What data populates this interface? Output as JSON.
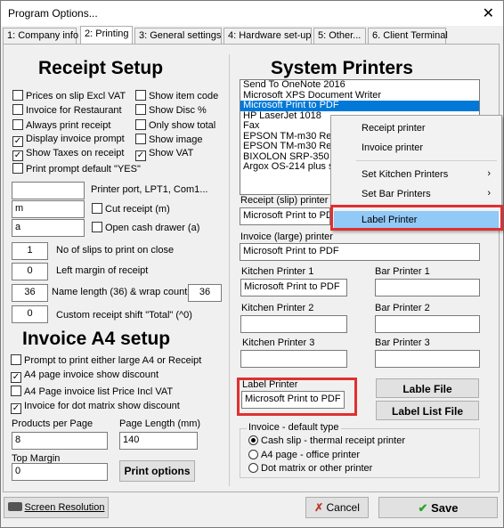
{
  "window": {
    "title": "Program Options...",
    "close_glyph": "✕"
  },
  "tabs": [
    "1: Company info",
    "2: Printing",
    "3: General settings",
    "4: Hardware set-up",
    "5: Other...",
    "6. Client Terminal"
  ],
  "receipt": {
    "title": "Receipt Setup",
    "checks_left": [
      {
        "label": "Prices on slip Excl VAT",
        "checked": false
      },
      {
        "label": "Invoice for Restaurant",
        "checked": false
      },
      {
        "label": "Always print receipt",
        "checked": false
      },
      {
        "label": "Display invoice prompt",
        "checked": true
      },
      {
        "label": "Show Taxes on receipt",
        "checked": true
      },
      {
        "label": "Print prompt default \"YES\"",
        "checked": false
      }
    ],
    "checks_right": [
      {
        "label": "Show item code",
        "checked": false
      },
      {
        "label": "Show Disc %",
        "checked": false
      },
      {
        "label": "Only show total",
        "checked": false
      },
      {
        "label": "Show image",
        "checked": false
      },
      {
        "label": "Show VAT",
        "checked": true
      }
    ],
    "port_label": "Printer port, LPT1, Com1...",
    "port_value": "",
    "cut_value": "m",
    "cut_label": "Cut receipt (m)",
    "drawer_value": "a",
    "drawer_label": "Open cash drawer (a)",
    "slips_value": "1",
    "slips_label": "No of slips to print on close",
    "margin_value": "0",
    "margin_label": "Left margin of receipt",
    "name_length_value": "36",
    "name_length_label": "Name length (36) & wrap count",
    "wrap_value": "36",
    "shift_value": "0",
    "shift_label": "Custom receipt shift \"Total\" (^0)"
  },
  "invoice": {
    "title": "Invoice A4 setup",
    "checks": [
      {
        "label": "Prompt to print either large A4 or Receipt",
        "checked": false
      },
      {
        "label": "A4 page invoice show discount",
        "checked": true
      },
      {
        "label": "A4 Page invoice list Price Incl VAT",
        "checked": false
      },
      {
        "label": "Invoice for dot matrix show discount",
        "checked": true
      }
    ],
    "products_label": "Products per Page",
    "products_value": "8",
    "page_length_label": "Page Length (mm)",
    "page_length_value": "140",
    "top_margin_label": "Top Margin",
    "top_margin_value": "0",
    "print_options_label": "Print options"
  },
  "system": {
    "title": "System Printers",
    "printers": [
      "Send To OneNote 2016",
      "Microsoft XPS Document Writer",
      "Microsoft Print to PDF",
      "HP LaserJet 1018",
      "Fax",
      "EPSON TM-m30 Re",
      "EPSON TM-m30 Re",
      "BIXOLON SRP-350",
      "Argox OS-214 plus s"
    ],
    "selected_index": 2,
    "receipt_label": "Receipt (slip) printer (r",
    "receipt_value": "Microsoft Print to PD",
    "invoice_label": "Invoice (large) printer",
    "invoice_value": "Microsoft Print to PDF",
    "kitchen1_label": "Kitchen Printer 1",
    "kitchen1_value": "Microsoft Print to PDF",
    "bar1_label": "Bar Printer 1",
    "bar1_value": "",
    "kitchen2_label": "Kitchen Printer 2",
    "kitchen2_value": "",
    "bar2_label": "Bar Printer 2",
    "bar2_value": "",
    "kitchen3_label": "Kitchen Printer 3",
    "kitchen3_value": "",
    "bar3_label": "Bar Printer 3",
    "bar3_value": "",
    "label_printer_label": "Label Printer",
    "label_printer_value": "Microsoft Print to PDF",
    "lable_file_button": "Lable File",
    "label_list_button": "Label List File",
    "invoice_type_legend": "Invoice - default type",
    "invoice_types": [
      {
        "label": "Cash slip - thermal receipt printer",
        "selected": true
      },
      {
        "label": "A4 page - office printer",
        "selected": false
      },
      {
        "label": "Dot matrix or other printer",
        "selected": false
      }
    ]
  },
  "context_menu": {
    "items": [
      "Receipt printer",
      "Invoice printer",
      "Set Kitchen Printers",
      "Set Bar Printers",
      "Label Printer"
    ],
    "arrow": "›"
  },
  "footer": {
    "screen_resolution": "Screen Resolution",
    "cancel": "Cancel",
    "save": "Save"
  },
  "colors": {
    "highlight": "#0078d7",
    "menu_highlight": "#91c9f7",
    "annotation_red": "#e03030",
    "save_check": "#2aa52a",
    "cancel_x": "#c0392b"
  }
}
